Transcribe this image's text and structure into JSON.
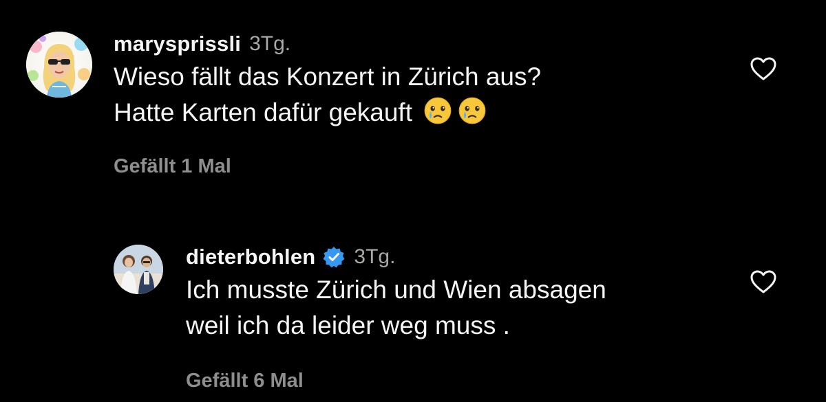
{
  "comments": [
    {
      "username": "marysprissli",
      "time": "3Tg.",
      "text_line1": "Wieso fällt das Konzert in Zürich aus?",
      "text_line2": "Hatte Karten dafür gekauft",
      "emoji": "face-holding-back-tears",
      "likes": "Gefällt 1 Mal",
      "verified": false
    },
    {
      "username": "dieterbohlen",
      "time": "3Tg.",
      "text_line1": "Ich musste Zürich und Wien absagen",
      "text_line2": "weil ich da leider weg muss .",
      "likes": "Gefällt 6 Mal",
      "verified": true
    }
  ],
  "colors": {
    "background": "#000000",
    "text": "#f5f5f5",
    "muted": "#a8a8a8",
    "likes": "#8e8e8e",
    "verified": "#3897f0"
  },
  "icons": {
    "like": "heart-outline-icon",
    "verified": "verified-badge-icon"
  }
}
